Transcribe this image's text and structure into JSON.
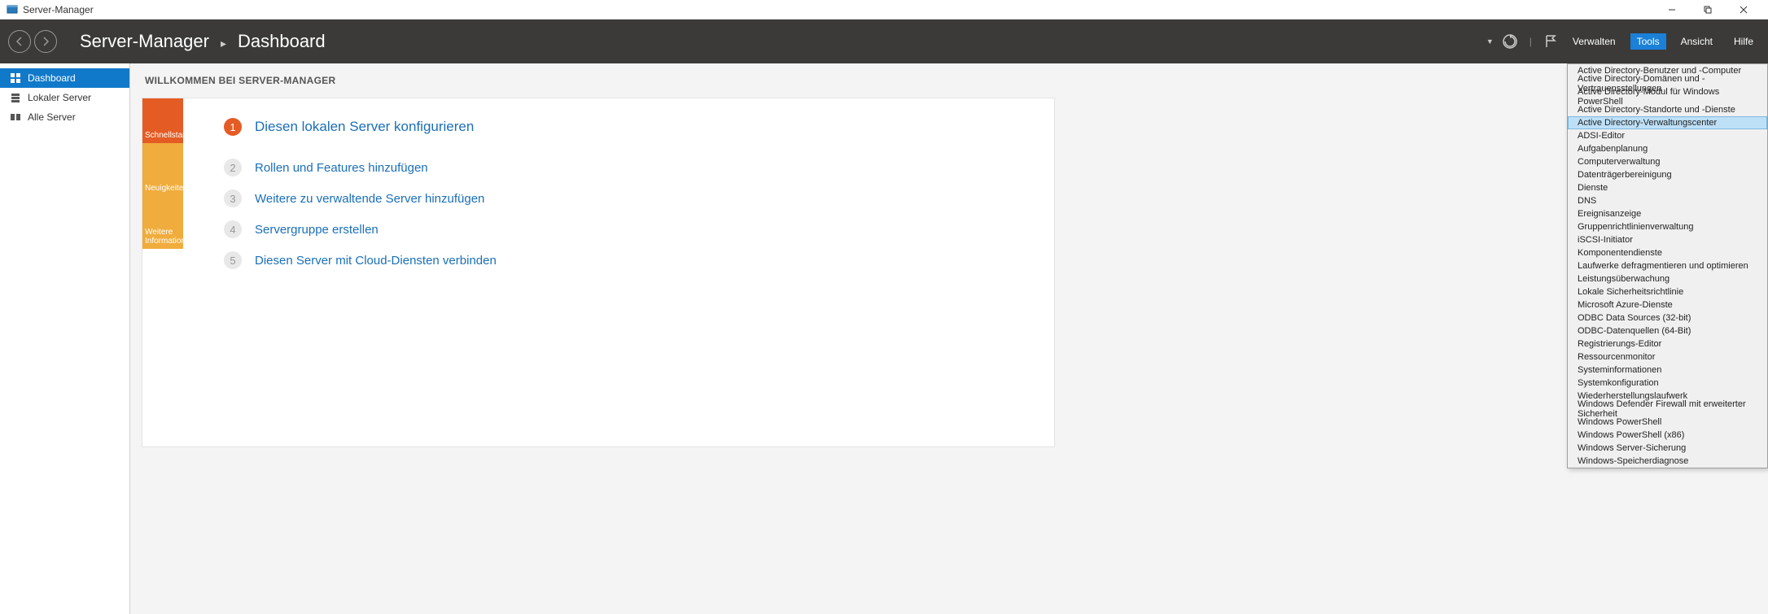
{
  "window": {
    "title": "Server-Manager"
  },
  "ribbon": {
    "app": "Server-Manager",
    "page": "Dashboard",
    "menu": {
      "verwalten": "Verwalten",
      "tools": "Tools",
      "ansicht": "Ansicht",
      "hilfe": "Hilfe"
    }
  },
  "sidebar": {
    "items": [
      {
        "label": "Dashboard"
      },
      {
        "label": "Lokaler Server"
      },
      {
        "label": "Alle Server"
      }
    ]
  },
  "main": {
    "welcome": "WILLKOMMEN BEI SERVER-MANAGER",
    "tabs": {
      "schnellstart": "Schnellstart",
      "neuigkeiten": "Neuigkeiten",
      "weitere": "Weitere Informationen"
    },
    "steps": [
      {
        "num": "1",
        "label": "Diesen lokalen Server konfigurieren"
      },
      {
        "num": "2",
        "label": "Rollen und Features hinzufügen"
      },
      {
        "num": "3",
        "label": "Weitere zu verwaltende Server hinzufügen"
      },
      {
        "num": "4",
        "label": "Servergruppe erstellen"
      },
      {
        "num": "5",
        "label": "Diesen Server mit Cloud-Diensten verbinden"
      }
    ]
  },
  "tools_menu": {
    "items": [
      "Active Directory-Benutzer und -Computer",
      "Active Directory-Domänen und -Vertrauensstellungen",
      "Active Directory-Modul für Windows PowerShell",
      "Active Directory-Standorte und -Dienste",
      "Active Directory-Verwaltungscenter",
      "ADSI-Editor",
      "Aufgabenplanung",
      "Computerverwaltung",
      "Datenträgerbereinigung",
      "Dienste",
      "DNS",
      "Ereignisanzeige",
      "Gruppenrichtlinienverwaltung",
      "iSCSI-Initiator",
      "Komponentendienste",
      "Laufwerke defragmentieren und optimieren",
      "Leistungsüberwachung",
      "Lokale Sicherheitsrichtlinie",
      "Microsoft Azure-Dienste",
      "ODBC Data Sources (32-bit)",
      "ODBC-Datenquellen (64-Bit)",
      "Registrierungs-Editor",
      "Ressourcenmonitor",
      "Systeminformationen",
      "Systemkonfiguration",
      "Wiederherstellungslaufwerk",
      "Windows Defender Firewall mit erweiterter Sicherheit",
      "Windows PowerShell",
      "Windows PowerShell (x86)",
      "Windows Server-Sicherung",
      "Windows-Speicherdiagnose"
    ],
    "highlight_index": 4
  }
}
